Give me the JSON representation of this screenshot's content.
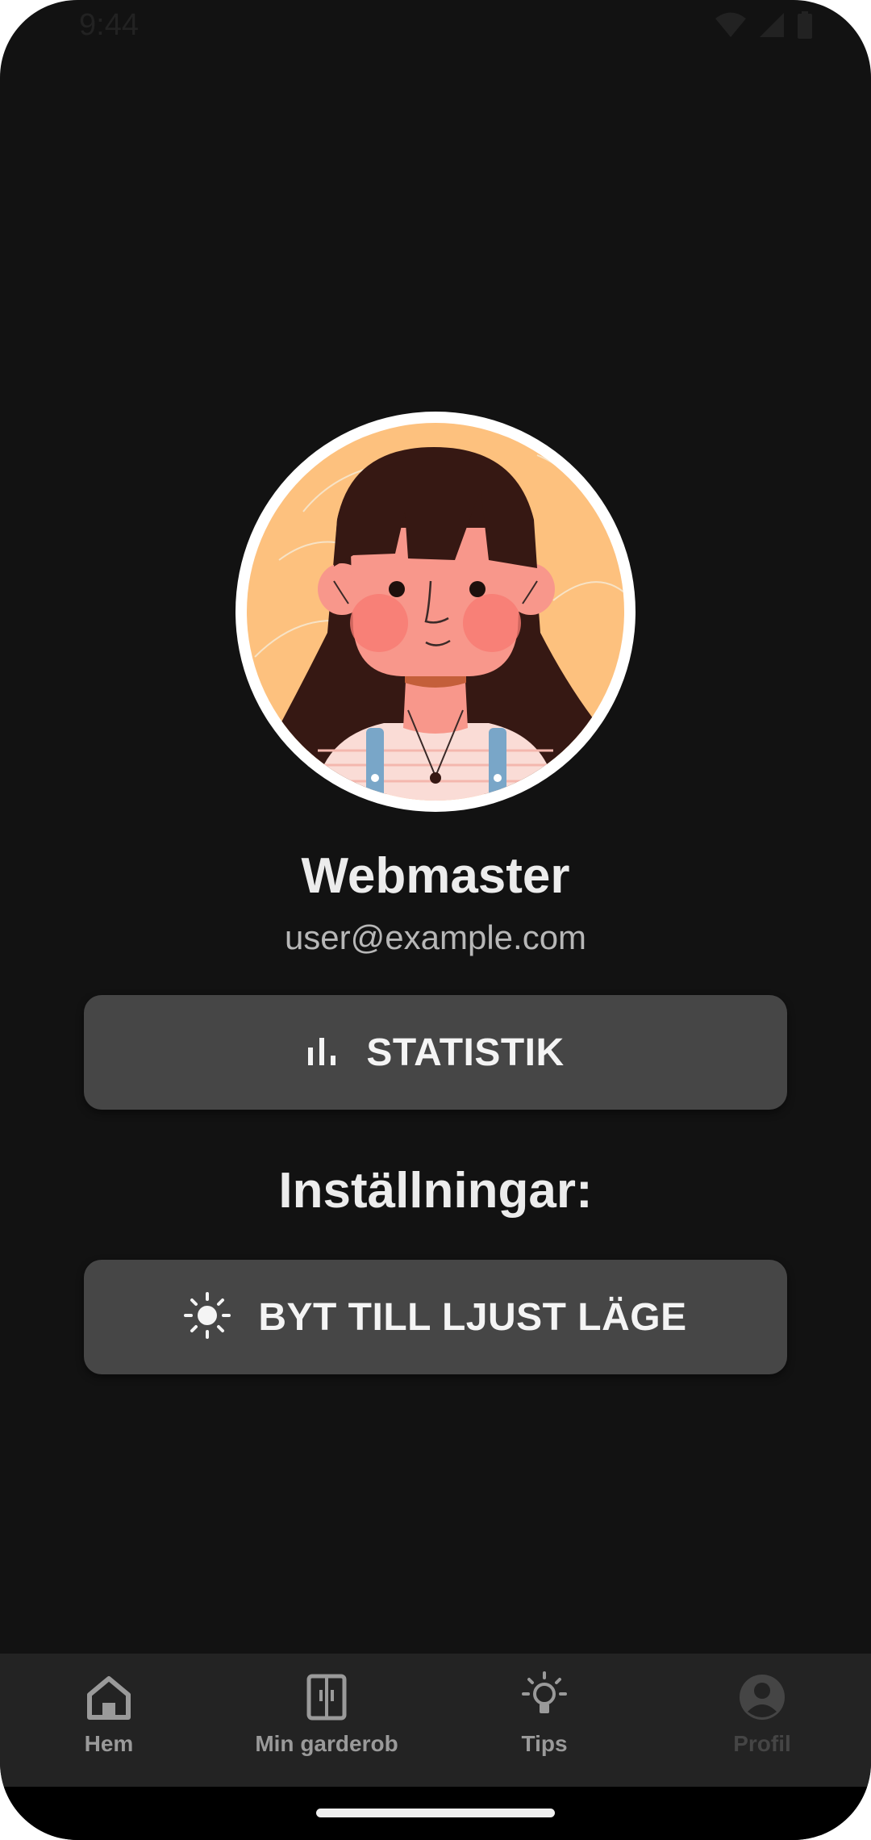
{
  "status_bar": {
    "time": "9:44",
    "icons": [
      "wifi-icon",
      "signal-icon",
      "battery-icon"
    ]
  },
  "profile": {
    "name": "Webmaster",
    "email": "user@example.com",
    "avatar": "avatar-illustration"
  },
  "statistics_button": {
    "label": "STATISTIK",
    "icon": "bar-chart-icon"
  },
  "settings": {
    "heading": "Inställningar:",
    "theme_button": {
      "label": "BYT TILL LJUST LÄGE",
      "icon": "sun-icon"
    }
  },
  "bottom_nav": {
    "items": [
      {
        "label": "Hem",
        "icon": "home-icon",
        "active": false
      },
      {
        "label": "Min garderob",
        "icon": "wardrobe-icon",
        "active": false
      },
      {
        "label": "Tips",
        "icon": "lightbulb-icon",
        "active": false
      },
      {
        "label": "Profil",
        "icon": "account-circle-icon",
        "active": true
      }
    ]
  },
  "colors": {
    "background": "#121212",
    "button": "#464646",
    "nav_background": "#232323",
    "text_primary": "#ececec",
    "text_secondary": "#b7b7b7",
    "nav_text": "#9a9a9a",
    "nav_text_active": "#454545"
  }
}
